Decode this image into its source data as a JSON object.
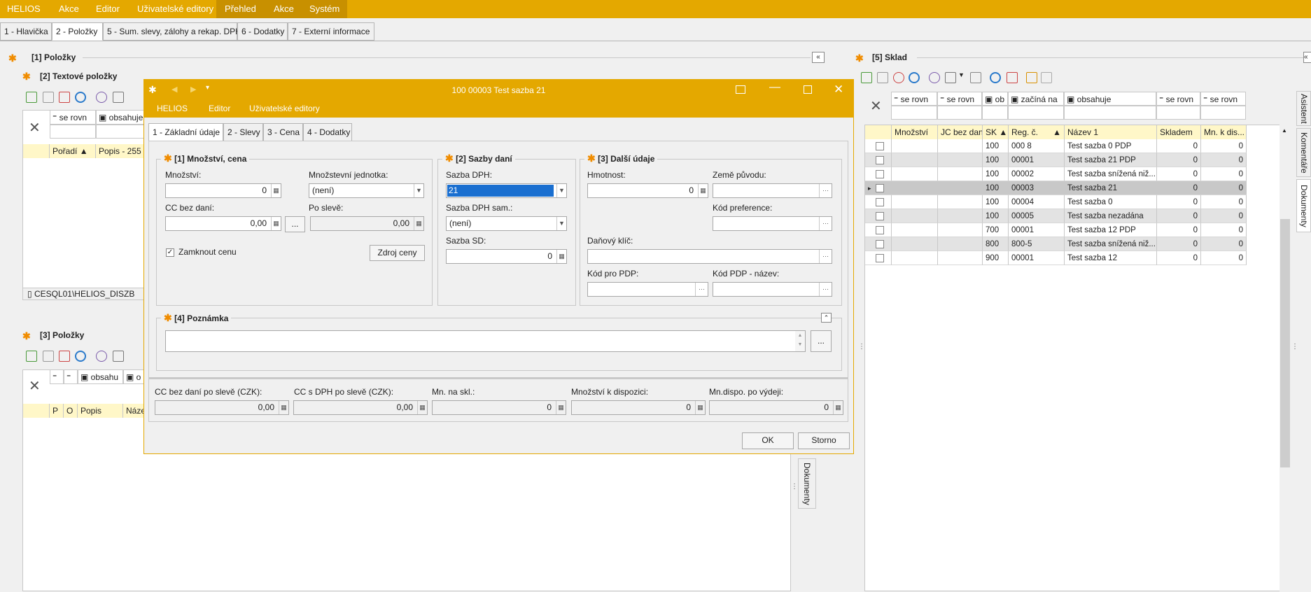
{
  "menubar": {
    "app": "HELIOS",
    "items": [
      "Akce",
      "Editor",
      "Uživatelské editory",
      "Přehled",
      "Akce",
      "Systém"
    ]
  },
  "main_tabs": [
    "1 - Hlavička",
    "2 - Položky",
    "5 - Sum. slevy, zálohy a rekap. DPH",
    "6 - Dodatky",
    "7 - Externí informace"
  ],
  "left": {
    "panel1_title": "[1] Položky",
    "panel2_title": "[2] Textové položky",
    "panel2_filters": [
      "se rovn",
      "obsahuje"
    ],
    "panel2_cols": [
      "Pořadí",
      "Popis - 255"
    ],
    "panel2_status": "CESQL01\\HELIOS_DISZB",
    "panel3_title": "[3] Položky",
    "panel3_filters": [
      "obsahu",
      "o"
    ],
    "panel3_cols": [
      "P",
      "O",
      "Popis",
      "Náze"
    ]
  },
  "sklad": {
    "title": "[5] Sklad",
    "filters": [
      "se rovn",
      "se rovn",
      "ob",
      "začíná na",
      "obsahuje",
      "se rovn",
      "se rovn"
    ],
    "columns": [
      "Množství",
      "JC bez daní",
      "SK",
      "Reg. č.",
      "Název 1",
      "Skladem",
      "Mn. k dis..."
    ],
    "rows": [
      {
        "sk": "100",
        "reg": "000 8",
        "name": "Test sazba 0 PDP",
        "skladem": "0",
        "mn": "0"
      },
      {
        "sk": "100",
        "reg": "00001",
        "name": "Test sazba 21 PDP",
        "skladem": "0",
        "mn": "0"
      },
      {
        "sk": "100",
        "reg": "00002",
        "name": "Test sazba snížená niž...",
        "skladem": "0",
        "mn": "0"
      },
      {
        "sk": "100",
        "reg": "00003",
        "name": "Test sazba 21",
        "skladem": "0",
        "mn": "0"
      },
      {
        "sk": "100",
        "reg": "00004",
        "name": "Test sazba 0",
        "skladem": "0",
        "mn": "0"
      },
      {
        "sk": "100",
        "reg": "00005",
        "name": "Test sazba nezadána",
        "skladem": "0",
        "mn": "0"
      },
      {
        "sk": "700",
        "reg": "00001",
        "name": "Test sazba 12 PDP",
        "skladem": "0",
        "mn": "0"
      },
      {
        "sk": "800",
        "reg": "800-5",
        "name": "Test sazba snížená niž...",
        "skladem": "0",
        "mn": "0"
      },
      {
        "sk": "900",
        "reg": "00001",
        "name": "Test sazba 12",
        "skladem": "0",
        "mn": "0"
      }
    ],
    "side_tabs": [
      "Asistent",
      "Komentáře",
      "Dokumenty"
    ]
  },
  "dialog": {
    "title": "100 00003 Test sazba 21",
    "menu": [
      "HELIOS",
      "Editor",
      "Uživatelské editory"
    ],
    "tabs": [
      "1 - Základní údaje",
      "2 - Slevy",
      "3 - Cena",
      "4 - Dodatky"
    ],
    "group1": {
      "title": "[1] Množství, cena",
      "mnozstvi_label": "Množství:",
      "mnozstvi": "0",
      "jednotka_label": "Množstevní jednotka:",
      "jednotka": "(není)",
      "cc_label": "CC bez daní:",
      "cc": "0,00",
      "po_sleve_label": "Po slevě:",
      "po_sleve": "0,00",
      "zamknout": "Zamknout cenu",
      "zdroj": "Zdroj ceny",
      "ellipsis": "..."
    },
    "group2": {
      "title": "[2] Sazby daní",
      "sazba_dph_label": "Sazba DPH:",
      "sazba_dph": "21",
      "sazba_sam_label": "Sazba DPH sam.:",
      "sazba_sam": "(není)",
      "sazba_sd_label": "Sazba SD:",
      "sazba_sd": "0"
    },
    "group3": {
      "title": "[3] Další údaje",
      "hmotnost_label": "Hmotnost:",
      "hmotnost": "0",
      "zeme_label": "Země původu:",
      "kod_pref_label": "Kód preference:",
      "danovy_label": "Daňový klíč:",
      "kod_pdp_label": "Kód pro PDP:",
      "kod_pdp_nazev_label": "Kód PDP - název:"
    },
    "group4": {
      "title": "[4] Poznámka"
    },
    "footer": {
      "labels": [
        "CC bez daní po slevě (CZK):",
        "CC s DPH po slevě (CZK):",
        "Mn. na skl.:",
        "Množství k dispozici:",
        "Mn.dispo. po výdeji:"
      ],
      "values": [
        "0,00",
        "0,00",
        "0",
        "0",
        "0"
      ]
    },
    "ok": "OK",
    "storno": "Storno"
  },
  "behind_tab": "Dokumenty"
}
